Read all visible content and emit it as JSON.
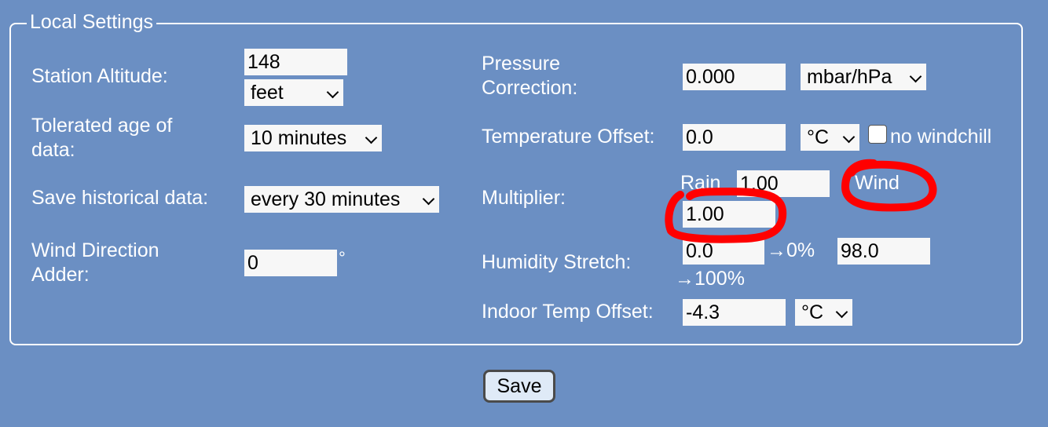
{
  "colors": {
    "background": "#6b8fc3",
    "annotation": "#ff0000"
  },
  "fieldset": {
    "legend": "Local Settings"
  },
  "left": {
    "altitude": {
      "label": "Station Altitude:",
      "value": "148",
      "unit": "feet"
    },
    "tolerated_age": {
      "label_line1": "Tolerated age of",
      "label_line2": "data:",
      "value": "10 minutes"
    },
    "save_historical": {
      "label": "Save historical data:",
      "value": "every 30 minutes"
    },
    "wind_direction": {
      "label_line1": "Wind Direction",
      "label_line2": "Adder:",
      "value": "0",
      "unit": "°"
    }
  },
  "right": {
    "pressure": {
      "label_line1": "Pressure",
      "label_line2": "Correction:",
      "value": "0.000",
      "unit": "mbar/hPa"
    },
    "temperature": {
      "label": "Temperature Offset:",
      "value": "0.0",
      "unit": "°C",
      "checkbox_label": "no windchill"
    },
    "multiplier": {
      "label": "Multiplier:",
      "rain_label": "Rain",
      "rain_value": "1.00",
      "wind_label": "Wind",
      "wind_value": "1.00"
    },
    "humidity": {
      "label": "Humidity Stretch:",
      "low_value": "0.0",
      "low_arrow": "→0%",
      "high_value": "98.0",
      "high_arrow": "→100%"
    },
    "indoor_temp": {
      "label": "Indoor Temp Offset:",
      "value": "-4.3",
      "unit": "°C"
    }
  },
  "save_button": {
    "label": "Save"
  }
}
